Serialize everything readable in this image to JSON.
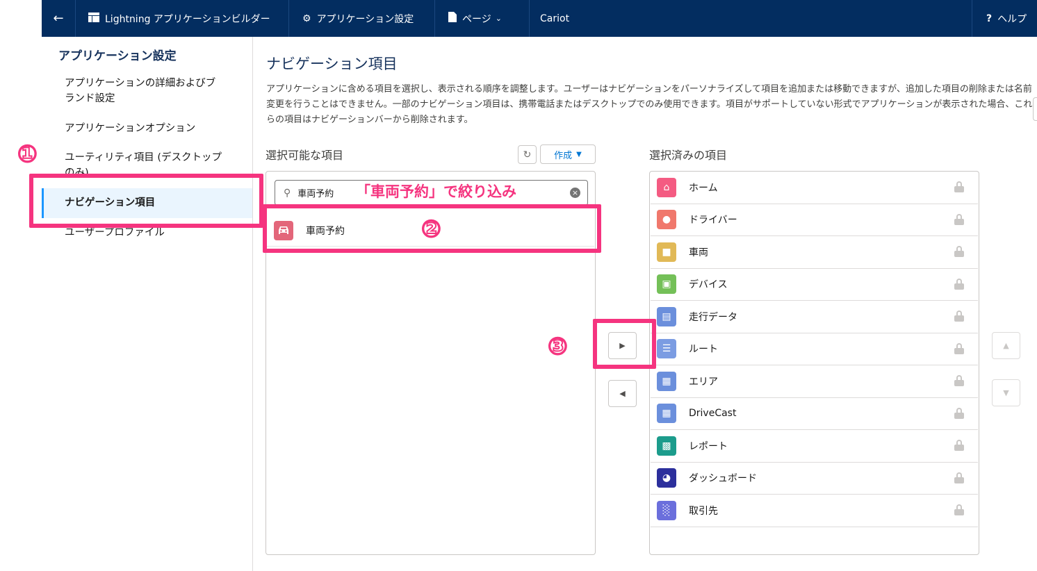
{
  "topbar": {
    "back_icon": "arrow-left-icon",
    "builder_label": "Lightning アプリケーションビルダー",
    "settings_label": "アプリケーション設定",
    "pages_label": "ページ",
    "app_name": "Cariot",
    "help_label": "ヘルプ",
    "background": "#032d60"
  },
  "sidebar": {
    "title": "アプリケーション設定",
    "items": [
      {
        "label": "アプリケーションの詳細およびブランド設定"
      },
      {
        "label": "アプリケーションオプション"
      },
      {
        "label": "ユーティリティ項目 (デスクトップのみ)"
      },
      {
        "label": "ナビゲーション項目",
        "active": true
      },
      {
        "label": "ユーザープロファイル"
      }
    ]
  },
  "main": {
    "title": "ナビゲーション項目",
    "description": "アプリケーションに含める項目を選択し、表示される順序を調整します。ユーザーはナビゲーションをパーソナライズして項目を追加または移動できますが、追加した項目の削除または名前変更を行うことはできません。一部のナビゲーション項目は、携帯電話またはデスクトップでのみ使用できます。項目がサポートしていない形式でアプリケーションが表示された場合、これらの項目はナビゲーションバーから削除されます。"
  },
  "available": {
    "label": "選択可能な項目",
    "refresh_icon": "refresh-icon",
    "create_label": "作成",
    "search_value": "車両予約",
    "items": [
      {
        "label": "車両予約",
        "icon": "car-icon",
        "color": "#e3667a"
      }
    ]
  },
  "selected": {
    "label": "選択済みの項目",
    "items": [
      {
        "label": "ホーム",
        "icon": "home-icon",
        "color": "#f45b82"
      },
      {
        "label": "ドライバー",
        "icon": "contact-icon",
        "color": "#f0786c"
      },
      {
        "label": "車両",
        "icon": "truck-icon",
        "color": "#e1b957"
      },
      {
        "label": "デバイス",
        "icon": "chip-icon",
        "color": "#74c058"
      },
      {
        "label": "走行データ",
        "icon": "screen-icon",
        "color": "#6b8fdc"
      },
      {
        "label": "ルート",
        "icon": "signpost-icon",
        "color": "#7b9ce2"
      },
      {
        "label": "エリア",
        "icon": "map-icon",
        "color": "#6b8fdc"
      },
      {
        "label": "DriveCast",
        "icon": "map-icon",
        "color": "#6b8fdc"
      },
      {
        "label": "レポート",
        "icon": "report-icon",
        "color": "#1c9c8c"
      },
      {
        "label": "ダッシュボード",
        "icon": "dashboard-icon",
        "color": "#2c2f9c"
      },
      {
        "label": "取引先",
        "icon": "building-icon",
        "color": "#6b6fdc"
      }
    ]
  },
  "annotations": {
    "step1": "①",
    "step2": "②",
    "step3": "③",
    "filter_note": "「車両予約」で絞り込み",
    "accent": "#f5347f"
  }
}
